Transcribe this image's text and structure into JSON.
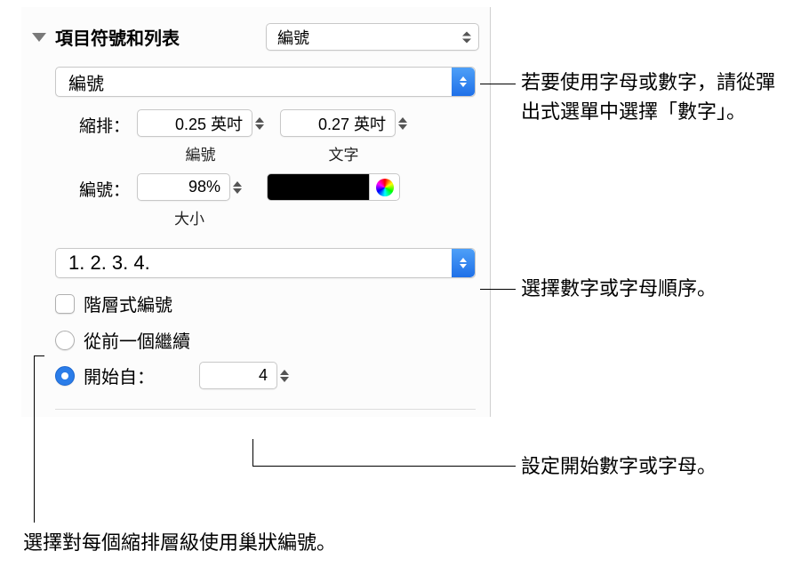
{
  "header": {
    "title": "項目符號和列表",
    "style_dropdown": "編號"
  },
  "type_dropdown": "編號",
  "indent": {
    "label": "縮排：",
    "number_value": "0.25 英吋",
    "number_label": "編號",
    "text_value": "0.27 英吋",
    "text_label": "文字"
  },
  "size": {
    "label": "編號：",
    "value": "98%",
    "sub_label": "大小"
  },
  "format_dropdown": "1. 2. 3. 4.",
  "hierarchical": {
    "label": "階層式編號"
  },
  "continue": {
    "label": "從前一個繼續"
  },
  "start_from": {
    "label": "開始自：",
    "value": "4"
  },
  "annotations": {
    "type_hint": "若要使用字母或數字，請從彈出式選單中選擇「數字」。",
    "format_hint": "選擇數字或字母順序。",
    "start_hint": "設定開始數字或字母。",
    "hierarchical_hint": "選擇對每個縮排層級使用巢狀編號。"
  }
}
